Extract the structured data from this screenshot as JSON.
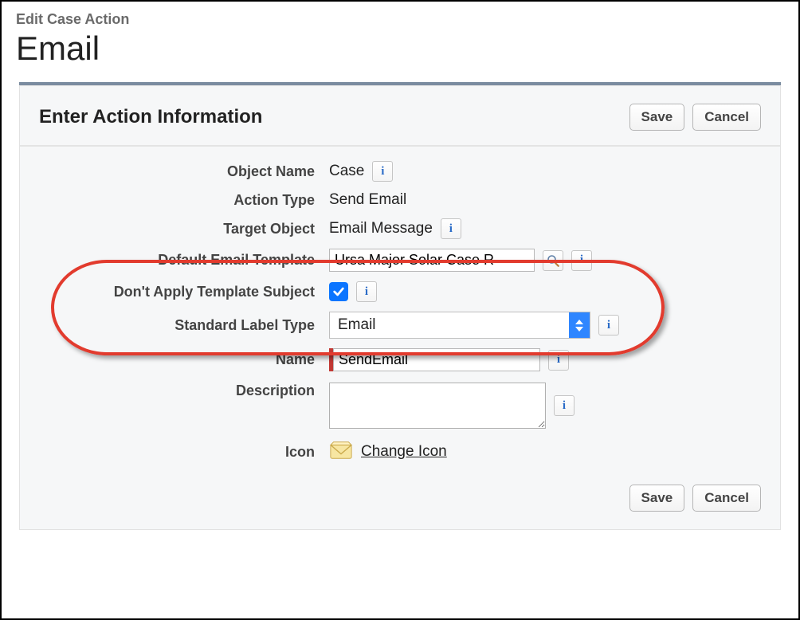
{
  "page": {
    "subtitle": "Edit Case Action",
    "title": "Email"
  },
  "panel": {
    "title": "Enter Action Information",
    "buttons": {
      "save": "Save",
      "cancel": "Cancel"
    }
  },
  "form": {
    "object_name": {
      "label": "Object Name",
      "value": "Case"
    },
    "action_type": {
      "label": "Action Type",
      "value": "Send Email"
    },
    "target_object": {
      "label": "Target Object",
      "value": "Email Message"
    },
    "default_email_template": {
      "label": "Default Email Template",
      "value": "Ursa Major Solar Case R"
    },
    "dont_apply_subject": {
      "label": "Don't Apply Template Subject",
      "checked": true
    },
    "standard_label_type": {
      "label": "Standard Label Type",
      "value": "Email"
    },
    "name": {
      "label": "Name",
      "value": "SendEmail"
    },
    "description": {
      "label": "Description",
      "value": ""
    },
    "icon": {
      "label": "Icon",
      "change_link": "Change Icon"
    }
  }
}
